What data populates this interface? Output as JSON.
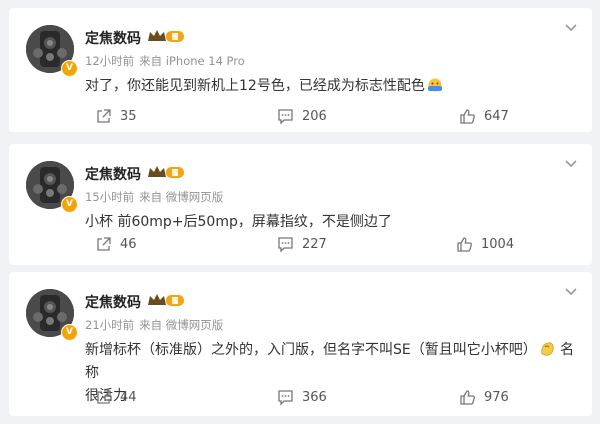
{
  "posts": [
    {
      "username": "定焦数码",
      "time": "12小时前",
      "source": "来自 iPhone 14 Pro",
      "content": "对了，你还能见到新机上12号色，已经成为标志性配色",
      "shares": "35",
      "comments": "206",
      "likes": "647"
    },
    {
      "username": "定焦数码",
      "time": "15小时前",
      "source": "来自 微博网页版",
      "content": "小杯 前60mp+后50mp，屏幕指纹，不是侧边了",
      "shares": "46",
      "comments": "227",
      "likes": "1004"
    },
    {
      "username": "定焦数码",
      "time": "21小时前",
      "source": "来自 微博网页版",
      "content_a": "新增标杯（标准版）之外的，入门版，但名字不叫SE（暂且叫它小杯吧）",
      "content_b": " 名称",
      "content_c": "很活力",
      "shares": "44",
      "comments": "366",
      "likes": "976"
    }
  ],
  "icons": {
    "verified": "verified-badge-icon",
    "vip": "vip-crown-icon",
    "more": "chevron-down-icon",
    "share": "share-icon",
    "comment": "comment-icon",
    "like": "like-icon"
  },
  "colors": {
    "background": "#f1f2f5",
    "card": "#ffffff",
    "verified": "#f5a300",
    "meta": "#939393"
  }
}
